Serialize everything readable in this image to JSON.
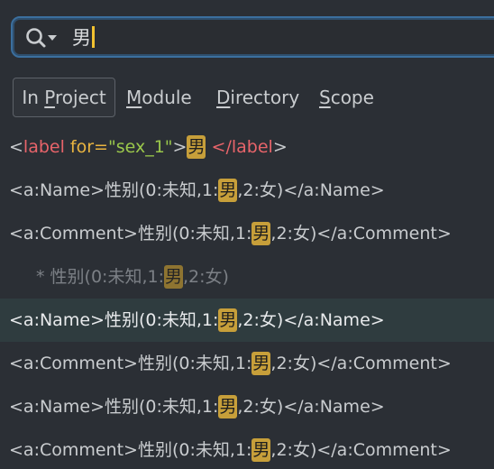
{
  "search": {
    "query": "男",
    "icon": "search-icon"
  },
  "tabs": [
    {
      "label": "In Project",
      "mnemonic_index": 3,
      "active": true
    },
    {
      "label": "Module",
      "mnemonic_index": 0,
      "active": false
    },
    {
      "label": "Directory",
      "mnemonic_index": 0,
      "active": false
    },
    {
      "label": "Scope",
      "mnemonic_index": 0,
      "active": false
    }
  ],
  "results": {
    "row0": {
      "open_bracket": "<",
      "tag": "label",
      "attr": " for=",
      "value": "\"sex_1\"",
      "close_bracket": ">",
      "match": "男",
      "after": " ",
      "end_tag": "</label",
      "end_bracket": ">"
    },
    "rows": [
      {
        "before": "<a:Name>性别(0:未知,1:",
        "match": "男",
        "after": ",2:女)</a:Name>",
        "selected": false,
        "dim": false
      },
      {
        "before": "<a:Comment>性别(0:未知,1:",
        "match": "男",
        "after": ",2:女)</a:Comment>",
        "selected": false,
        "dim": false
      },
      {
        "before": "* 性别(0:未知,1:",
        "match": "男",
        "after": ",2:女)",
        "selected": false,
        "dim": true
      },
      {
        "before": "<a:Name>性别(0:未知,1:",
        "match": "男",
        "after": ",2:女)</a:Name>",
        "selected": true,
        "dim": false
      },
      {
        "before": "<a:Comment>性别(0:未知,1:",
        "match": "男",
        "after": ",2:女)</a:Comment>",
        "selected": false,
        "dim": false
      },
      {
        "before": "<a:Name>性别(0:未知,1:",
        "match": "男",
        "after": ",2:女)</a:Name>",
        "selected": false,
        "dim": false
      },
      {
        "before": "<a:Comment>性别(0:未知,1:",
        "match": "男",
        "after": ",2:女)</a:Comment>",
        "selected": false,
        "dim": false
      }
    ]
  },
  "colors": {
    "background": "#2b2f35",
    "focus_border": "#3b6f9e",
    "match_highlight": "#c79f3a",
    "selected_row": "#2f3c3f",
    "tag": "#e8646a",
    "attribute": "#e9b440",
    "string": "#9ac74b",
    "caret": "#f2c230"
  }
}
